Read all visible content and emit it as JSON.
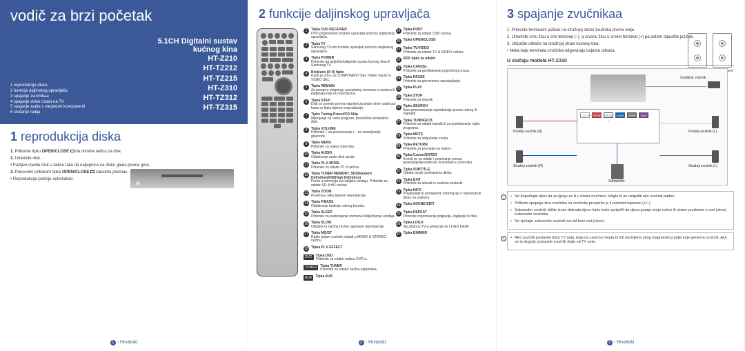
{
  "panel1": {
    "guide_title": "vodič za brzi početak",
    "system_line1": "5.1CH Digitalni sustav",
    "system_line2": "kućnog kina",
    "models": [
      "HT-Z210",
      "HT-TZ212",
      "HT-TZ215",
      "HT-Z310",
      "HT-TZ312",
      "HT-TZ315"
    ],
    "toc": [
      "1 reprodukcija diska",
      "2 funkcije daljinskog upravljača",
      "3 spajanje zvučnikaa",
      "4 spajanje video izlaza na TV",
      "5 spajanje audia s vanjskom komponenti",
      "6 slušanje radija"
    ],
    "section_num": "1",
    "section_title": "reprodukcija diska",
    "steps": [
      {
        "n": "1.",
        "pre": "Pritisnite tipku ",
        "b": "OPEN/CLOSE ",
        "post": " da otvorite ladicu za disk."
      },
      {
        "n": "2.",
        "pre": "Umetnite disk.",
        "b": "",
        "post": ""
      },
      {
        "n": "",
        "pre": "• Pažljivo stavite disk u ladicu tako da naljepnica na disku gleda prema gore.",
        "b": "",
        "post": ""
      },
      {
        "n": "3.",
        "pre": "Ponovnim pritiskom tipke ",
        "b": "OPEN/CLOSE ",
        "post": " zatvorite pretinac."
      },
      {
        "n": "",
        "pre": "• Reprodukcija počinje automatski.",
        "b": "",
        "post": ""
      }
    ],
    "footer_num": "1",
    "footer_lang": "- Hrvatski"
  },
  "panel2": {
    "section_num": "2",
    "section_title": "funkcije daljinskog upravljača",
    "left": [
      {
        "n": "1",
        "t": "Tipka DVD RECEIVER",
        "d": "DVD prijamnikom možete upravljati pomoću daljinskog upravljača."
      },
      {
        "n": "2",
        "t": "Tipka TV",
        "d": "Samsung TV-om možete upravljati pomoću daljinskog upravljača."
      },
      {
        "n": "3",
        "t": "Tipka POWER",
        "d": "Pritisnite da uključite/isključite sustav kućnog kina ili Samsung TV."
      },
      {
        "n": "4",
        "t": "Brojčane (0~9) tipke",
        "d": "Kada je unos za COMPONENT SEL (Video input) S-VIDEO SEL."
      },
      {
        "n": "5",
        "t": "Tipka REMAIN",
        "d": "Za provjeru ukupnog i preostalog vremena u naslovu ili poglavlju koje se reproducira."
      },
      {
        "n": "6",
        "t": "Tipka STEP",
        "d": "Disk se pomiče prema naprijed za jedan okvir svaki put kada se tipka tijekom reprodukcije."
      },
      {
        "n": "7",
        "t": "Tipke Tuning Preset/CD Skip",
        "d": "Mijenjanje na radio program, preskočite kompaktni disk."
      },
      {
        "n": "8",
        "t": "Tipka VOLUME",
        "d": "Pritisnite + za povećavanje i – za smanjivanje glasnoće."
      },
      {
        "n": "9",
        "t": "Tipke MENU",
        "d": "Pritisnite za prikaz izbornika."
      },
      {
        "n": "10",
        "t": "Tipka AUDIO",
        "d": "Odabiranje audio disk opcije."
      },
      {
        "n": "11",
        "t": "Tipka PL II MODE",
        "d": "Pritisnite za odabir PL II načina."
      },
      {
        "n": "12",
        "t": "Tipka TUNER MEMORY, SD(Standard Definition)/HD(High Definition)",
        "d": "Prima u memoriju za radijsku postaju. Pritisnite za odabir SD ili HD načina."
      },
      {
        "n": "13",
        "t": "Tipka ZOOM",
        "d": "Povećava sliku tijekom reprodukcije."
      },
      {
        "n": "14",
        "t": "Tipka P.BASS",
        "d": "Odabiranje funkcije ručnog kormila."
      },
      {
        "n": "15",
        "t": "Tipka SLEEP",
        "d": "Pritisnite za postavljanje vremena isključivanja uređaja."
      },
      {
        "n": "16",
        "t": "Tipka SLOW",
        "d": "Odabire tri načina brzine usporene reprodukcije."
      },
      {
        "n": "17",
        "t": "Tipka MO/ST",
        "d": "Radio prijam možete slušati u MONO ili STEREO načinu."
      },
      {
        "n": "18",
        "t": "Tipka PL II EFFECT",
        "d": ""
      }
    ],
    "right": [
      {
        "n": "19",
        "t": "Tipka PORT",
        "d": "Pritisnite za odabir USB načina."
      },
      {
        "n": "20",
        "t": "Tipka OPEN/CLOSE",
        "d": ""
      },
      {
        "n": "21",
        "t": "Tipka TV/VIDEO",
        "d": "Pritisnite za odabir TV ili VIDEO načina."
      },
      {
        "n": "22",
        "t": "RDS tipke za odabir",
        "d": ""
      },
      {
        "n": "23",
        "t": "Tipka CANCEL",
        "d": "Pritisnite za poništavanje pogrešnog unosa."
      },
      {
        "n": "24",
        "t": "Tipka PAUSE",
        "d": "Pritisnite za privremeno zaustavljanje."
      },
      {
        "n": "25",
        "t": "Tipka PLAY",
        "d": ""
      },
      {
        "n": "25b",
        "t": "Tipka STOP",
        "d": "Pritisnite za izlazak."
      },
      {
        "n": "26",
        "t": "Tipke SEARCH",
        "d": "Brzo premotavanje reprodukcije prema natrag ili naprijed."
      },
      {
        "n": "27",
        "t": "Tipka TUNING/CH",
        "d": "Pritisnite za odabir kanala ili za podešavanje radio programa."
      },
      {
        "n": "28",
        "t": "Tipka MUTE",
        "d": "Pritisnite za isključenje zvuka."
      },
      {
        "n": "29",
        "t": "Tipka RETURN",
        "d": "Pritisnite za povratak na naslov."
      },
      {
        "n": "30",
        "t": "Tipka Cursor/ENTER",
        "d": "Koristi se za odabir i pomicanje prema gore/dolje/lijevo/desno ili postavki u izborniku."
      },
      {
        "n": "31",
        "t": "Tipka SUBTITLE",
        "d": "Odabir opcije podnaslova diska."
      },
      {
        "n": "32",
        "t": "Tipka EXIT",
        "d": "Pritisnite za izlazak iz zaslona postavki."
      },
      {
        "n": "33",
        "t": "Tipka INFO",
        "d": "Pregledajte ili promijenite informacije o reprodukciji diska na zaslonu."
      },
      {
        "n": "34",
        "t": "Tipka SOUND EDIT",
        "d": ""
      },
      {
        "n": "35",
        "t": "Tipka REPEAT",
        "d": "Ponovite reprodukciju poglavlja, zaglavlje ili disk."
      },
      {
        "n": "36",
        "t": "Tipka LOGO",
        "d": "Na zaslonu TV-a prikazuje se LOGO DATA."
      },
      {
        "n": "37",
        "t": "Tipka DIMMER",
        "d": ""
      }
    ],
    "bottom": [
      {
        "tag": "DVD",
        "t": "Tipka DVD",
        "d": "Pritisnite za odabir načina DVD-a."
      },
      {
        "tag": "TUNER",
        "t": "Tipka TUNER",
        "d": "Pritisnite za odabir načina prijamnika."
      },
      {
        "tag": "AUX",
        "t": "Tipka AUX",
        "d": ""
      }
    ],
    "footer_num": "2",
    "footer_lang": "- Hrvatski"
  },
  "panel3": {
    "section_num": "3",
    "section_title": "spajanje zvučnikaa",
    "steps": [
      {
        "n": "1.",
        "t": "Pritisnite terminalni jezičak na stražnjoj strani zvučnika prema dolje."
      },
      {
        "n": "2.",
        "t": "Umetnite crnu žicu u crni terminal (–), a crvenu žicu u crveni terminal (+) pa potom otpustite jezičak."
      },
      {
        "n": "3.",
        "t": "Uključite utikače na stražnjoj strani kućnog kina."
      },
      {
        "n": "3b",
        "t": "• Neka boje terminala zvučnika odgovaraju bojama utikača."
      }
    ],
    "term_labels": {
      "black": "Crno",
      "red": "Crveno"
    },
    "diagram_title": "U slučaju modela HT-Z310",
    "speakers": {
      "center": "Središnji zvučnik",
      "fr": "Prednji zvučnik (R)",
      "fl": "Prednji zvučnik (L)",
      "br": "Stražnji zvučnik (R)",
      "bl": "Stražnji zvučnik (L)",
      "sub": "Subwoofer"
    },
    "ports": [
      "CENTER",
      "FRONT R",
      "FRONT L",
      "SURR R",
      "SURR L",
      "SUB"
    ],
    "note1": [
      "Ne dopuštajte djeci da se igraju sa ili u blizini zvučnika. Mogla bi se ozlijediti ako zvučnik padne.",
      "Prilikom spajanja žica zvučnika na zvučnike provjerite je li polaritet ispravan (+/–).",
      "Subwoofer zvučnik držite izvan dohvata djece kako biste spriječili da djeca guraju svoje ručice ili strane predmete u vod (otvor) subwoofer zvučnika.",
      "Ne vješajte subwoofer zvučnik na zid kroz vod (otvor)."
    ],
    "note2": [
      "Ako zvučnik postavite blizu TV seta, boja na zaslonu mogla bi biti iskrivljena zbog magnetskog polja koje generira zvučnik. Ako se to dogodi, postavite zvučnik dalje od TV seta."
    ],
    "footer_num": "3",
    "footer_lang": "- Hrvatski"
  }
}
